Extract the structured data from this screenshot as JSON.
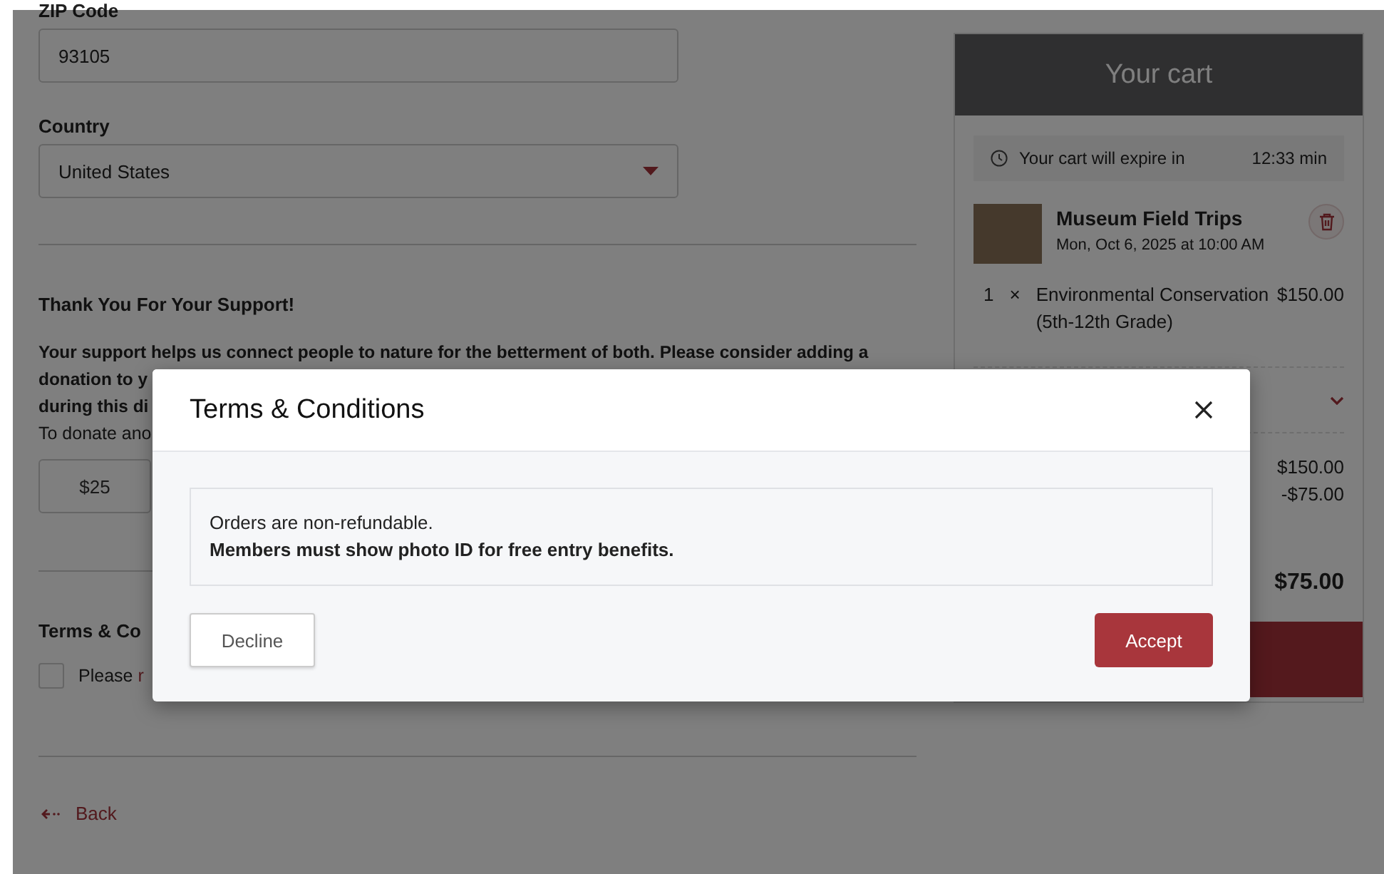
{
  "form": {
    "zip": {
      "label": "ZIP Code",
      "value": "93105"
    },
    "country": {
      "label": "Country",
      "value": "United States"
    },
    "support": {
      "title": "Thank You For Your Support!",
      "lines": [
        "Your support helps us connect people to nature for the betterment of both. Please consider adding a",
        "donation to y",
        "during this di"
      ],
      "note": "To donate ano",
      "amounts": [
        "$25"
      ]
    },
    "terms": {
      "title": "Terms & Co",
      "text": "Please ",
      "link": "r",
      "checked": false
    },
    "back": "Back"
  },
  "cart": {
    "title": "Your cart",
    "expire_label": "Your cart will expire in",
    "expire_time": "12:33 min",
    "item": {
      "title": "Museum Field Trips",
      "date": "Mon, Oct 6, 2025 at 10:00 AM",
      "lines": [
        {
          "qty": "1",
          "x": "×",
          "name": "Environmental Conservation (5th-12th Grade)",
          "price": "$150.00"
        }
      ]
    },
    "amounts": [
      "$150.00",
      "-$75.00"
    ],
    "total": "$75.00"
  },
  "modal": {
    "title": "Terms & Conditions",
    "lines": [
      {
        "text": "Orders are non-refundable.",
        "bold": false
      },
      {
        "text": "Members must show photo ID for free entry benefits.",
        "bold": true
      }
    ],
    "decline": "Decline",
    "accept": "Accept"
  }
}
